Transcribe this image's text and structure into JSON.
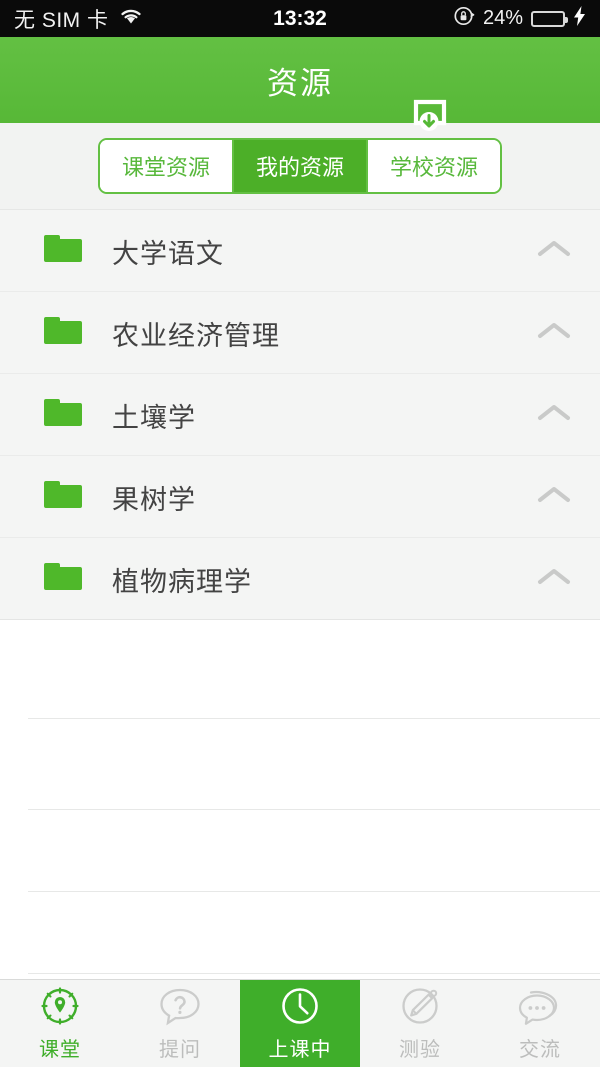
{
  "status_bar": {
    "carrier": "无 SIM 卡",
    "wifi_icon": "wifi-icon",
    "time": "13:32",
    "rotation_lock_icon": "rotation-lock-icon",
    "battery_percent": "24%",
    "battery_level": 30,
    "charging_icon": "lightning-bolt-icon"
  },
  "header": {
    "title": "资源",
    "download_icon": "download-icon"
  },
  "tabs": {
    "items": [
      {
        "label": "课堂资源",
        "active": false
      },
      {
        "label": "我的资源",
        "active": true
      },
      {
        "label": "学校资源",
        "active": false
      }
    ]
  },
  "folder_list": {
    "chevron_icon": "chevron-up-icon",
    "folder_icon": "folder-icon",
    "items": [
      {
        "label": "大学语文"
      },
      {
        "label": "农业经济管理"
      },
      {
        "label": "土壤学"
      },
      {
        "label": "果树学"
      },
      {
        "label": "植物病理学"
      }
    ]
  },
  "bottom_nav": {
    "items": [
      {
        "label": "课堂",
        "icon": "compass-icon",
        "state": "selected"
      },
      {
        "label": "提问",
        "icon": "question-bubble-icon",
        "state": "inactive"
      },
      {
        "label": "上课中",
        "icon": "clock-icon",
        "state": "active"
      },
      {
        "label": "测验",
        "icon": "pencil-circle-icon",
        "state": "inactive"
      },
      {
        "label": "交流",
        "icon": "chat-bubbles-icon",
        "state": "inactive"
      }
    ]
  },
  "colors": {
    "brand_green": "#5ebe3f",
    "active_green": "#4caf28",
    "nav_active_green": "#3fae2a",
    "folder_green": "#4fb82a",
    "list_bg": "#f4f5f4",
    "inactive_gray": "#bcbdbc"
  }
}
